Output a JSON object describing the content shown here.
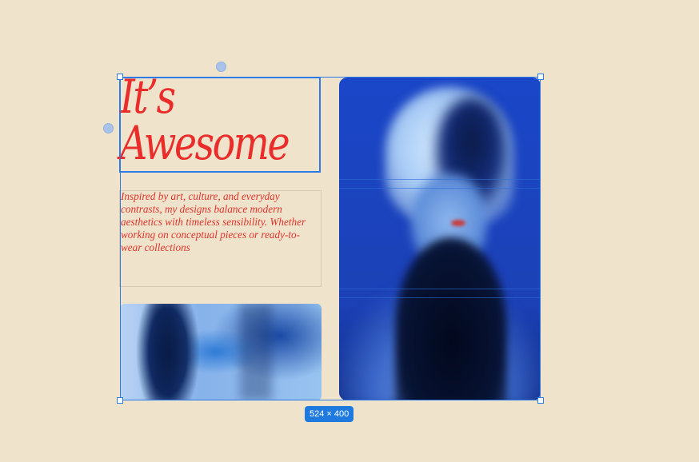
{
  "headline": {
    "line": "It’s\nAwesome",
    "color": "#ea2d2a"
  },
  "paragraph": {
    "text": "Inspired by art, culture, and everyday contrasts, my designs balance modern aesthetics with timeless sensibility. Whether working on conceptual pieces or ready-to-wear collections",
    "color": "#e0332a"
  },
  "images": {
    "small": {
      "subject": "blurred blue figure with raised hand"
    },
    "tall": {
      "subject": "blurred portrait, woman with bob haircut in blue light"
    }
  },
  "selection": {
    "dimension_label": "524 × 400",
    "accent": "#2d7be6"
  },
  "background": "#efe3cc"
}
